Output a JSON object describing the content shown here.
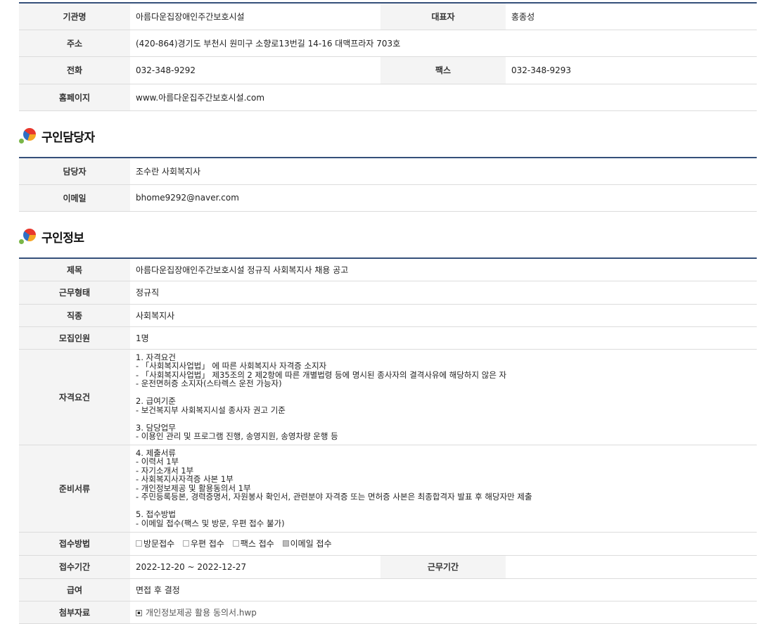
{
  "org": {
    "rows": [
      {
        "label": "기관명",
        "value": "아름다운집장애인주간보호시설",
        "label2": "대표자",
        "value2": "홍종성"
      },
      {
        "label": "주소",
        "value": "(420-864)경기도 부천시 원미구 소향로13번길 14-16 대맥프라자 703호"
      },
      {
        "label": "전화",
        "value": "032-348-9292",
        "label2": "팩스",
        "value2": "032-348-9293"
      },
      {
        "label": "홈페이지",
        "value": "www.아름다운집주간보호시설.com"
      }
    ]
  },
  "contact": {
    "title": "구인담당자",
    "rows": [
      {
        "label": "담당자",
        "value": "조수란 사회복지사"
      },
      {
        "label": "이메일",
        "value": "bhome9292@naver.com"
      }
    ]
  },
  "job": {
    "title": "구인정보",
    "rows": [
      {
        "label": "제목",
        "value": "아름다운집장애인주간보호시설 정규직 사회복지사 채용 공고"
      },
      {
        "label": "근무형태",
        "value": "정규직"
      },
      {
        "label": "직종",
        "value": "사회복지사"
      },
      {
        "label": "모집인원",
        "value": "1명"
      },
      {
        "label": "자격요건",
        "value": "1. 자격요건\n- 「사회복지사업법」 에 따른 사회복지사 자격증 소지자\n- 「사회복지사업법」 제35조의 2 제2항에 따른 개별법령 등에 명시된 종사자의 결격사유에 해당하지 않은 자\n- 운전면허증 소지자(스타렉스 운전 가능자)\n\n2. 급여기준\n- 보건복지부 사회복지시설 종사자 권고 기준\n\n3. 담당업무\n- 이용인 관리 및 프로그램 진행, 송영지원, 송영차량 운행 등"
      },
      {
        "label": "준비서류",
        "value": "4. 제출서류\n- 이력서 1부\n- 자기소개서 1부\n- 사회복지사자격증 사본 1부\n- 개인정보제공 및 활용동의서 1부\n- 주민등록등본, 경력증명서, 자원봉사 확인서, 관련분야 자격증 또는 면허증 사본은 최종합격자 발표 후 해당자만 제출\n\n5. 접수방법\n- 이메일 접수(팩스 및 방문, 우편 접수 불가)"
      }
    ],
    "apply": {
      "label": "접수방법",
      "options": [
        {
          "label": "방문접수",
          "checked": false
        },
        {
          "label": "우편 접수",
          "checked": false
        },
        {
          "label": "팩스 접수",
          "checked": false
        },
        {
          "label": "이메일 접수",
          "checked": true
        }
      ]
    },
    "period": {
      "label": "접수기간",
      "value": "2022-12-20 ~ 2022-12-27",
      "label2": "근무기간",
      "value2": ""
    },
    "salary": {
      "label": "급여",
      "value": "면접 후 결정"
    },
    "attach": {
      "label": "첨부자료",
      "file": "개인정보제공 활용 동의서.hwp"
    }
  }
}
